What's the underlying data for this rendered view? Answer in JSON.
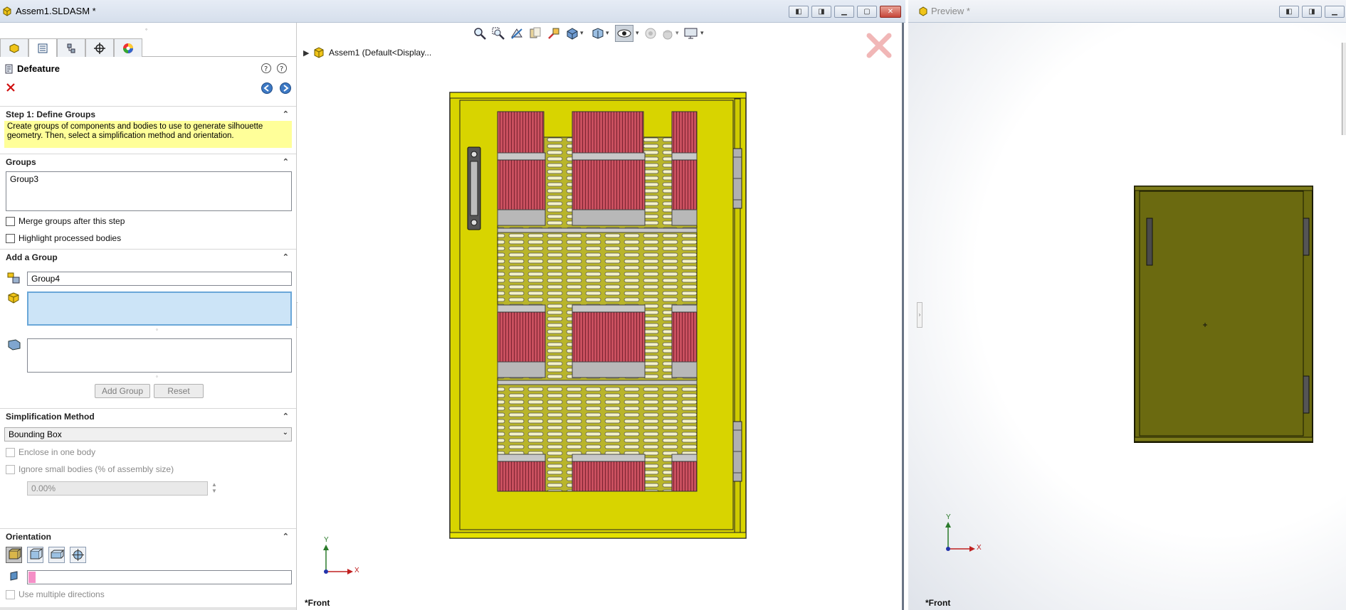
{
  "main_window": {
    "title": "Assem1.SLDASM *"
  },
  "preview_window": {
    "title": "Preview *"
  },
  "panel": {
    "title": "Defeature",
    "step1_header": "Step 1: Define Groups",
    "step1_message": "Create groups of components and bodies to use to generate silhouette geometry. Then, select a simplification method and orientation.",
    "groups_header": "Groups",
    "groups_list": [
      "Group3"
    ],
    "merge_groups_label": "Merge groups after this step",
    "highlight_label": "Highlight processed bodies",
    "add_group_header": "Add a Group",
    "group_name_value": "Group4",
    "add_group_button": "Add Group",
    "reset_button": "Reset",
    "simplification_header": "Simplification Method",
    "simplification_value": "Bounding Box",
    "enclose_label": "Enclose in one body",
    "ignore_small_label": "Ignore small bodies (% of assembly size)",
    "ignore_small_value": "0.00%",
    "orientation_header": "Orientation",
    "multiple_directions_label": "Use multiple directions"
  },
  "viewport": {
    "tree_root": "Assem1  (Default<Display...",
    "view_label": "*Front",
    "axis_x": "X",
    "axis_y": "Y"
  },
  "preview": {
    "view_label": "*Front",
    "axis_x": "X",
    "axis_y": "Y"
  },
  "colors": {
    "door_yellow": "#d8d400",
    "preview_olive": "#6b6a10",
    "banner_yellow": "#ffff99",
    "selection_blue": "#cce4f7",
    "red_fins": "#c9505f"
  }
}
